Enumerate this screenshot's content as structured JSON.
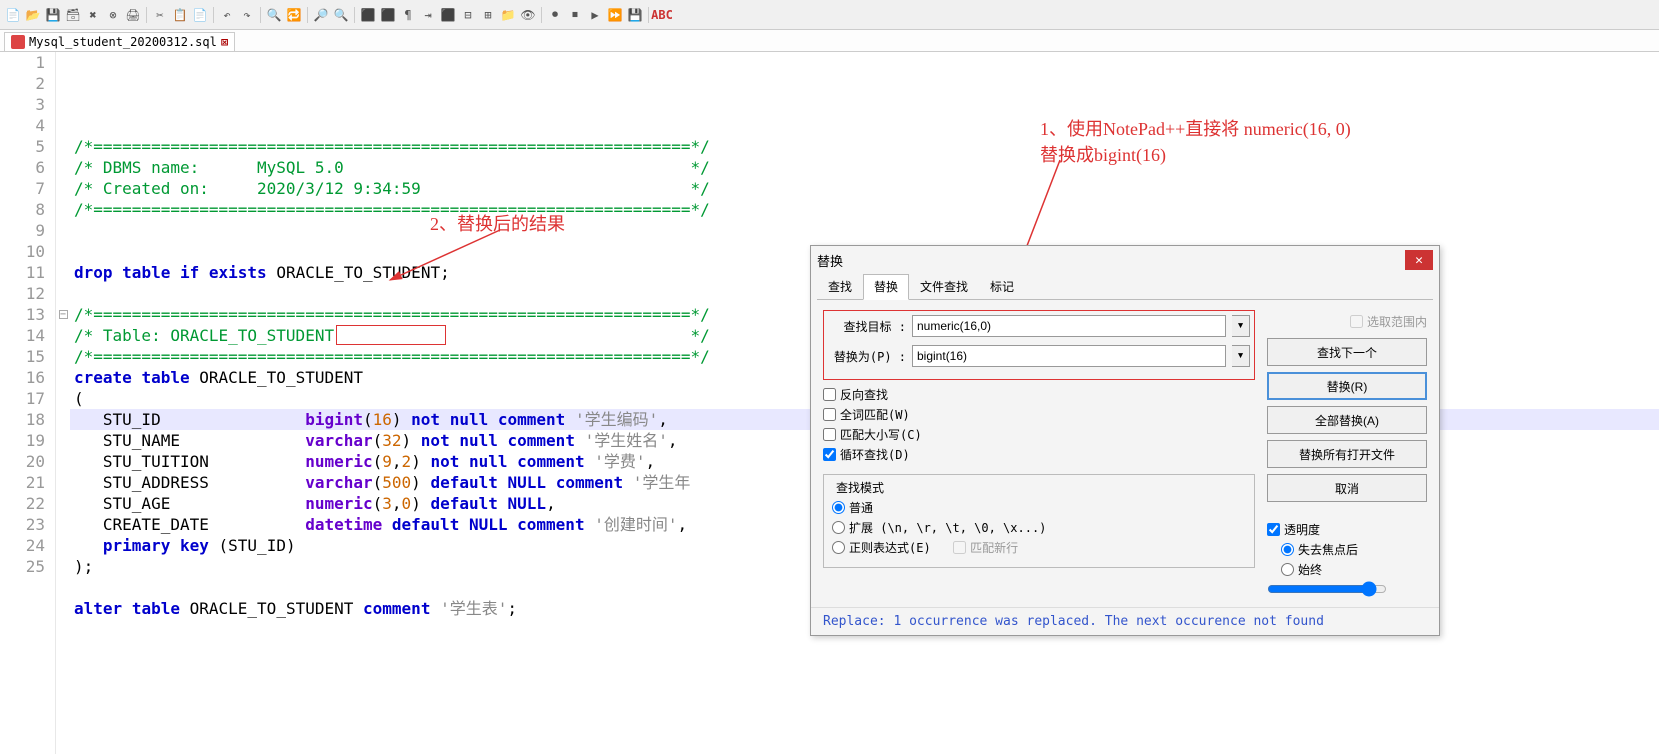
{
  "file_tab": {
    "name": "Mysql_student_20200312.sql"
  },
  "annotations": {
    "a1": "1、使用NotePad++直接将 numeric(16, 0)\n替换成bigint(16)",
    "a2": "2、替换后的结果"
  },
  "dialog": {
    "title": "替换",
    "tabs": [
      "查找",
      "替换",
      "文件查找",
      "标记"
    ],
    "active_tab": 1,
    "find_label": "查找目标 :",
    "find_value": "numeric(16,0)",
    "replace_label": "替换为(P) :",
    "replace_value": "bigint(16)",
    "in_selection": "选取范围内",
    "btn_find_next": "查找下一个",
    "btn_replace": "替换(R)",
    "btn_replace_all": "全部替换(A)",
    "btn_replace_in_open": "替换所有打开文件",
    "btn_cancel": "取消",
    "chk_backward": "反向查找",
    "chk_whole_word": "全词匹配(W)",
    "chk_match_case": "匹配大小写(C)",
    "chk_wrap": "循环查找(D)",
    "grp_mode": "查找模式",
    "mode_normal": "普通",
    "mode_extended": "扩展 (\\n, \\r, \\t, \\0, \\x...)",
    "mode_regex": "正则表达式(E)",
    "mode_regex_nl": "匹配新行",
    "grp_trans": "透明度",
    "trans_onlose": "失去焦点后",
    "trans_always": "始终",
    "status": "Replace: 1 occurrence was replaced. The next occurence not found"
  },
  "code_lines": [
    {
      "n": 1,
      "cls": "c-comment",
      "t": "/*==============================================================*/"
    },
    {
      "n": 2,
      "cls": "c-comment",
      "t": "/* DBMS name:      MySQL 5.0                                    */"
    },
    {
      "n": 3,
      "cls": "c-comment",
      "t": "/* Created on:     2020/3/12 9:34:59                            */"
    },
    {
      "n": 4,
      "cls": "c-comment",
      "t": "/*==============================================================*/"
    },
    {
      "n": 5,
      "t": ""
    },
    {
      "n": 6,
      "t": ""
    },
    {
      "n": 7,
      "html": "<span class='c-kw'>drop</span> <span class='c-kw'>table</span> <span class='c-kw'>if</span> <span class='c-kw'>exists</span> ORACLE_TO_STUDENT;"
    },
    {
      "n": 8,
      "t": ""
    },
    {
      "n": 9,
      "cls": "c-comment",
      "t": "/*==============================================================*/"
    },
    {
      "n": 10,
      "cls": "c-comment",
      "t": "/* Table: ORACLE_TO_STUDENT                                     */"
    },
    {
      "n": 11,
      "cls": "c-comment",
      "t": "/*==============================================================*/"
    },
    {
      "n": 12,
      "html": "<span class='c-kw'>create</span> <span class='c-kw'>table</span> ORACLE_TO_STUDENT"
    },
    {
      "n": 13,
      "t": "(",
      "fold": "-"
    },
    {
      "n": 14,
      "hl": true,
      "html": "   STU_ID               <span class='c-type'>bigint</span>(<span class='c-num'>16</span>) <span class='c-kw'>not</span> <span class='c-kw'>null</span> <span class='c-kw'>comment</span> <span class='c-str'>'学生编码'</span>,"
    },
    {
      "n": 15,
      "html": "   STU_NAME             <span class='c-type'>varchar</span>(<span class='c-num'>32</span>) <span class='c-kw'>not</span> <span class='c-kw'>null</span> <span class='c-kw'>comment</span> <span class='c-str'>'学生姓名'</span>,"
    },
    {
      "n": 16,
      "html": "   STU_TUITION          <span class='c-type'>numeric</span>(<span class='c-num'>9</span>,<span class='c-num'>2</span>) <span class='c-kw'>not</span> <span class='c-kw'>null</span> <span class='c-kw'>comment</span> <span class='c-str'>'学费'</span>,"
    },
    {
      "n": 17,
      "html": "   STU_ADDRESS          <span class='c-type'>varchar</span>(<span class='c-num'>500</span>) <span class='c-kw'>default</span> <span class='c-kw'>NULL</span> <span class='c-kw'>comment</span> <span class='c-str'>'学生年"
    },
    {
      "n": 18,
      "html": "   STU_AGE              <span class='c-type'>numeric</span>(<span class='c-num'>3</span>,<span class='c-num'>0</span>) <span class='c-kw'>default</span> <span class='c-kw'>NULL</span>,"
    },
    {
      "n": 19,
      "html": "   CREATE_DATE          <span class='c-type'>datetime</span> <span class='c-kw'>default</span> <span class='c-kw'>NULL</span> <span class='c-kw'>comment</span> <span class='c-str'>'创建时间'</span>,"
    },
    {
      "n": 20,
      "html": "   <span class='c-kw'>primary</span> <span class='c-kw'>key</span> (STU_ID)"
    },
    {
      "n": 21,
      "t": ");"
    },
    {
      "n": 22,
      "t": ""
    },
    {
      "n": 23,
      "html": "<span class='c-kw'>alter</span> <span class='c-kw'>table</span> ORACLE_TO_STUDENT <span class='c-kw'>comment</span> <span class='c-str'>'学生表'</span>;"
    },
    {
      "n": 24,
      "t": ""
    },
    {
      "n": 25,
      "t": ""
    }
  ],
  "toolbar_icons": [
    "new",
    "open",
    "save",
    "save-all",
    "close",
    "close-all",
    "print",
    "cut",
    "copy",
    "paste",
    "undo",
    "redo",
    "find",
    "replace",
    "zoom-in",
    "zoom-out",
    "sync",
    "wrap",
    "all-chars",
    "indent",
    "lang",
    "fold",
    "unfold",
    "hide",
    "view",
    "rec",
    "stop",
    "play",
    "play-mult",
    "save-macro",
    "spellcheck"
  ]
}
